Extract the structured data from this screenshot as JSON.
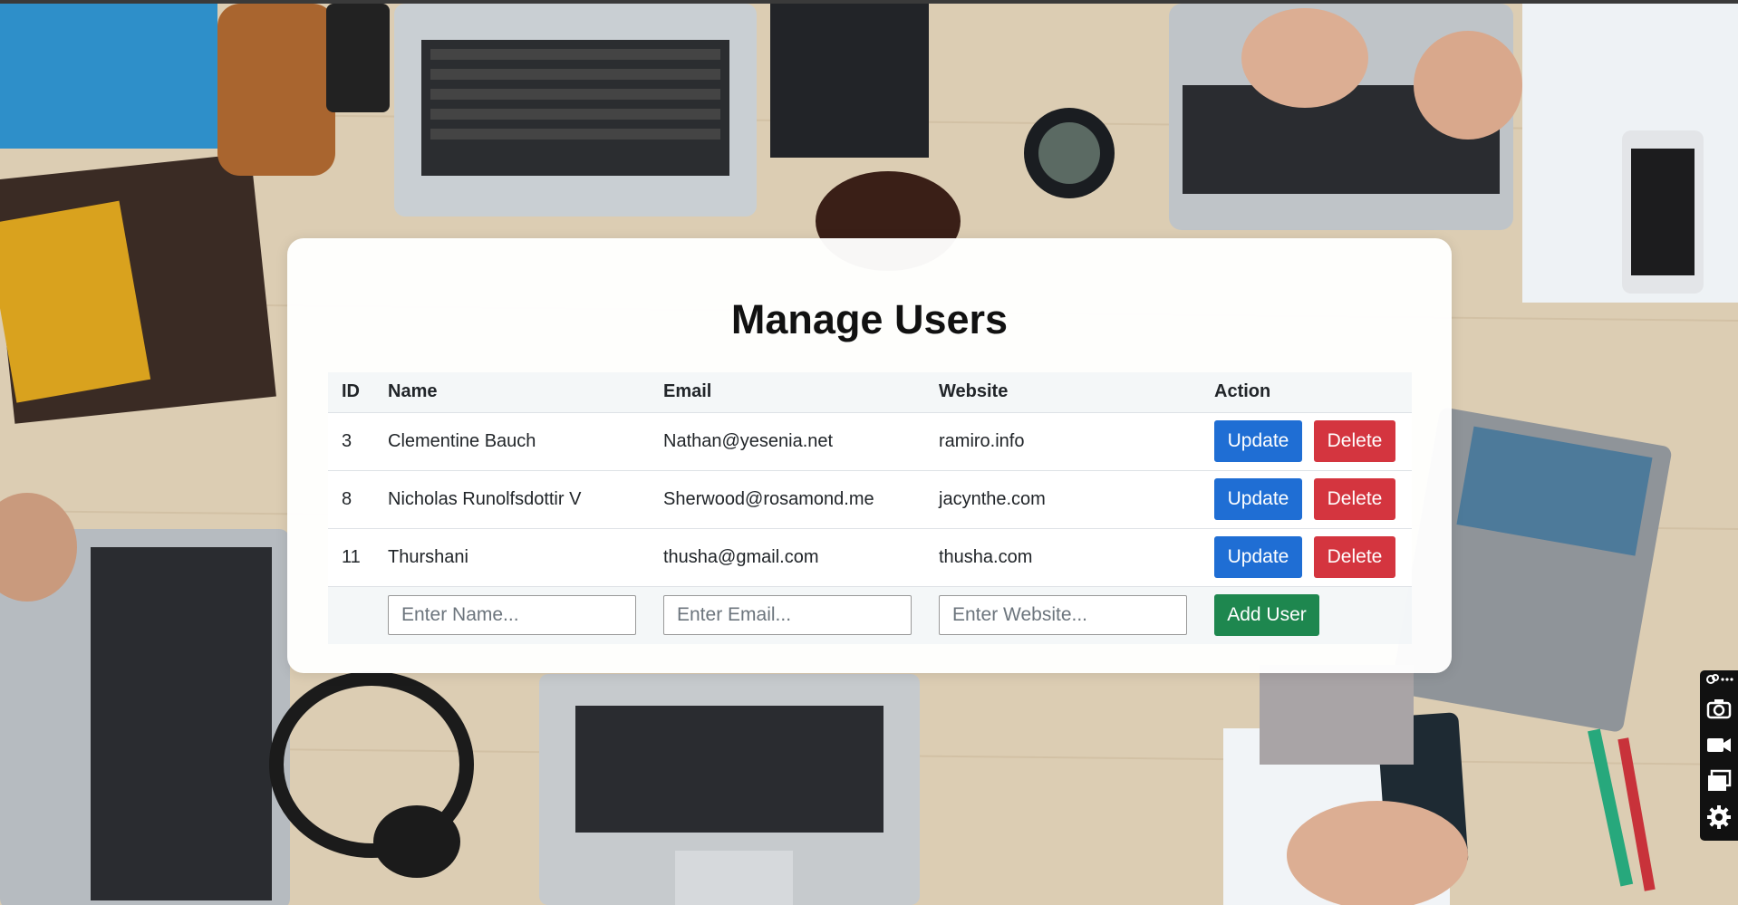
{
  "page": {
    "title": "Manage Users"
  },
  "table": {
    "headers": {
      "id": "ID",
      "name": "Name",
      "email": "Email",
      "website": "Website",
      "action": "Action"
    },
    "rows": [
      {
        "id": "3",
        "name": "Clementine Bauch",
        "email": "Nathan@yesenia.net",
        "website": "ramiro.info"
      },
      {
        "id": "8",
        "name": "Nicholas Runolfsdottir V",
        "email": "Sherwood@rosamond.me",
        "website": "jacynthe.com"
      },
      {
        "id": "11",
        "name": "Thurshani",
        "email": "thusha@gmail.com",
        "website": "thusha.com"
      }
    ],
    "update_label": "Update",
    "delete_label": "Delete"
  },
  "add_form": {
    "name_placeholder": "Enter Name...",
    "email_placeholder": "Enter Email...",
    "website_placeholder": "Enter Website...",
    "add_label": "Add User"
  },
  "toolbar": {
    "icons": [
      "link-icon",
      "more-icon",
      "camera-icon",
      "video-icon",
      "window-icon",
      "settings-icon"
    ]
  },
  "colors": {
    "update": "#1f6ed4",
    "delete": "#d4353f",
    "add": "#1e874f",
    "card": "#ffffff"
  }
}
